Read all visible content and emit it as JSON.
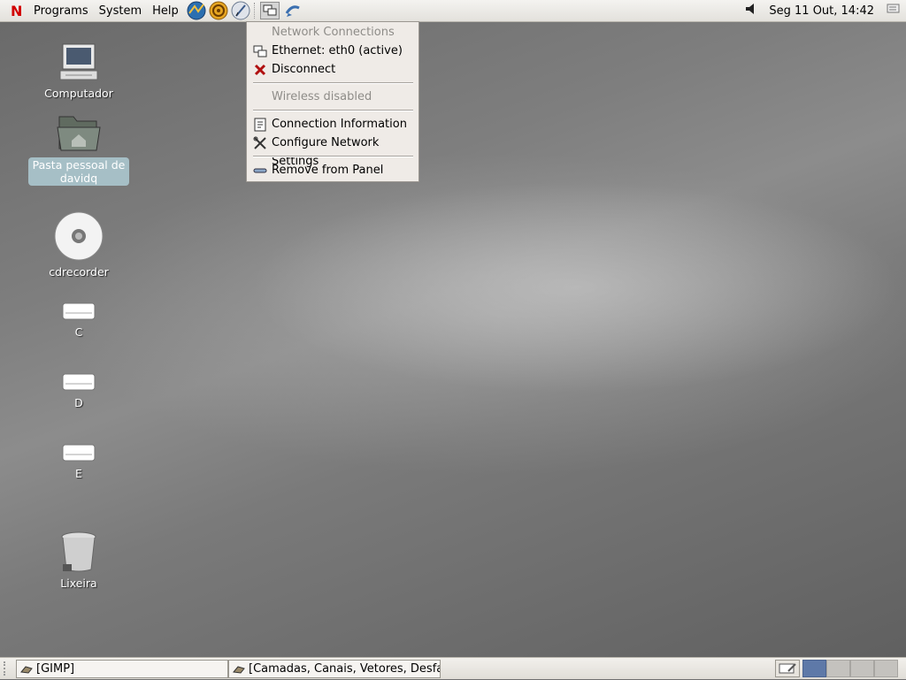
{
  "top_panel": {
    "logo": "N",
    "menus": [
      "Programs",
      "System",
      "Help"
    ],
    "launchers": [
      "web-browser-icon",
      "email-icon",
      "text-editor-icon"
    ],
    "clock": "Seg 11 Out, 14:42"
  },
  "desktop_icons": [
    {
      "label": "Computador",
      "icon": "computer-icon"
    },
    {
      "label": "Pasta pessoal de davidq",
      "icon": "home-folder-icon",
      "selected": true
    },
    {
      "label": "cdrecorder",
      "icon": "cd-icon"
    },
    {
      "label": "C",
      "icon": "drive-icon"
    },
    {
      "label": "D",
      "icon": "drive-icon"
    },
    {
      "label": "E",
      "icon": "drive-icon"
    },
    {
      "label": "Lixeira",
      "icon": "trash-icon"
    }
  ],
  "network_menu": {
    "header": "Network Connections",
    "ethernet": "Ethernet: eth0 (active)",
    "disconnect": "Disconnect",
    "wireless": "Wireless disabled",
    "connection_info": "Connection Information",
    "configure": "Configure Network Settings",
    "remove": "Remove from Panel"
  },
  "taskbar": {
    "tasks": [
      "[GIMP]",
      "[Camadas, Canais, Vetores, Desfazer]"
    ],
    "workspaces": 4,
    "active_workspace": 1
  }
}
